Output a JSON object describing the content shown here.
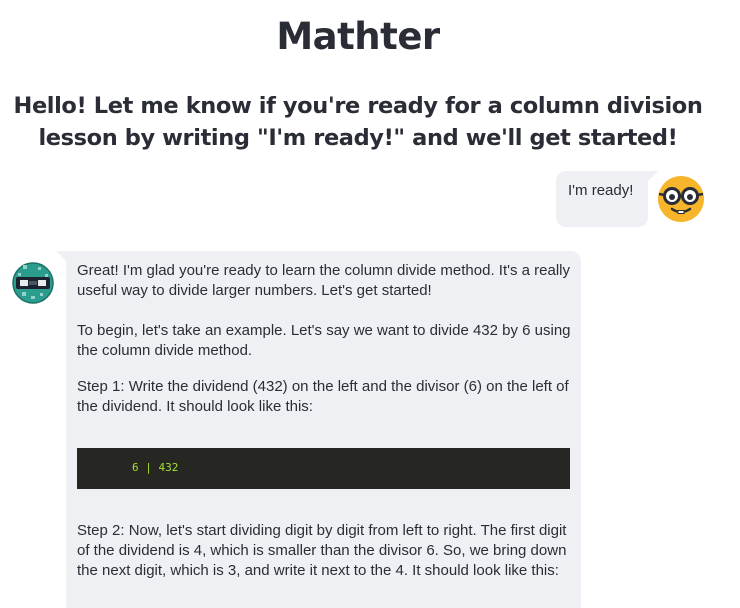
{
  "app": {
    "title": "Mathter"
  },
  "intro": {
    "text": "Hello! Let me know if you're ready for a column division lesson by writing \"I'm ready!\" and we'll get started!"
  },
  "messages": {
    "user": {
      "text": "I'm ready!",
      "avatar_icon": "nerd-face-emoji-icon"
    },
    "bot": {
      "avatar_icon": "robot-avatar-icon",
      "paragraphs": [
        "Great! I'm glad you're ready to learn the column divide method. It's a really useful way to divide larger numbers. Let's get started!",
        "To begin, let's take an example. Let's say we want to divide 432 by 6 using the column divide method.",
        "Step 1: Write the dividend (432) on the left and the divisor (6) on the left of the dividend. It should look like this:",
        "Step 2: Now, let's start dividing digit by digit from left to right. The first digit of the dividend is 4, which is smaller than the divisor 6. So, we bring down the next digit, which is 3, and write it next to the 4. It should look like this:"
      ],
      "code": "6 | 432"
    }
  },
  "colors": {
    "text": "#2a2d36",
    "bubble": "#eef0f3",
    "code_bg": "#262622",
    "code_text": "#a6e22e",
    "emoji_yellow": "#f7b52c",
    "robot_teal": "#2a9d8f"
  }
}
